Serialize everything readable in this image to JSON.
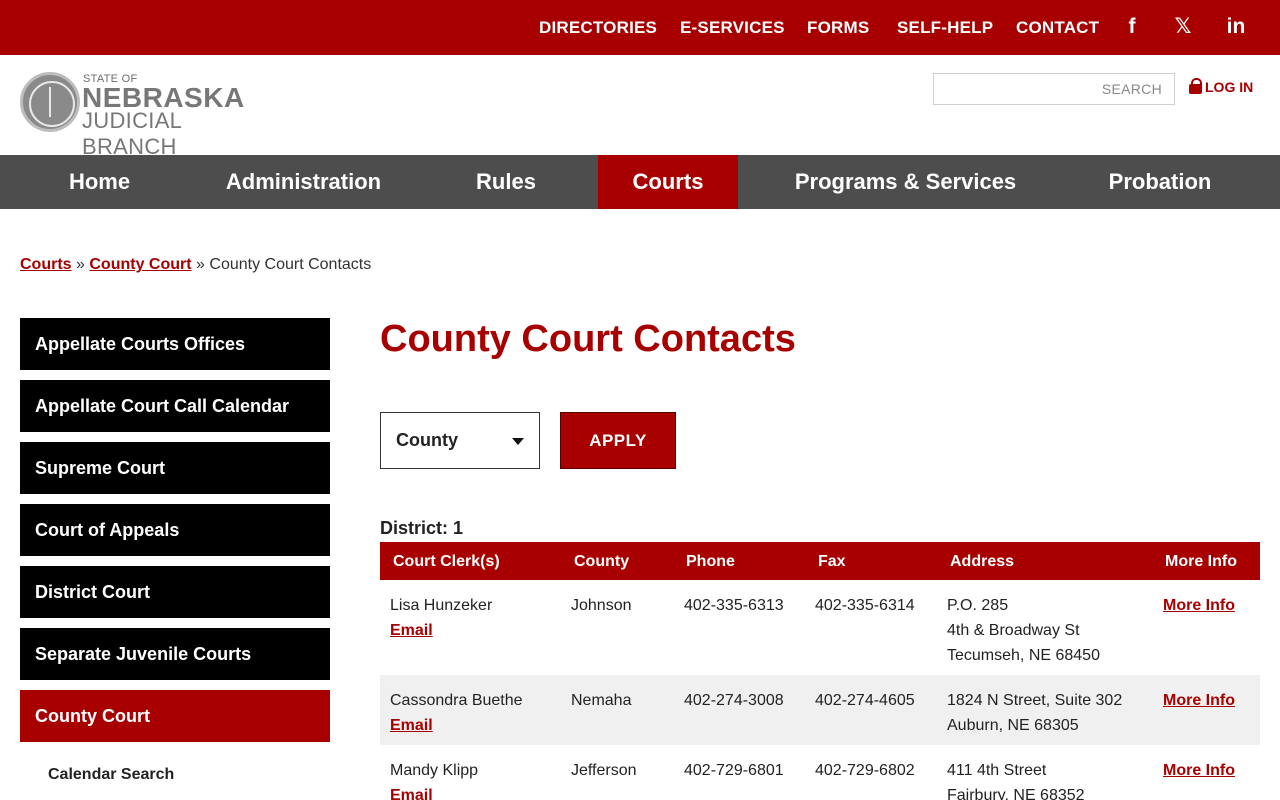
{
  "colors": {
    "brand_red": "#a80000",
    "nav_gray": "#4d4d4d",
    "sidebar_black": "#000000"
  },
  "top_links": [
    "DIRECTORIES",
    "E-SERVICES",
    "FORMS",
    "SELF-HELP",
    "CONTACT"
  ],
  "social": [
    {
      "icon": "facebook-icon",
      "glyph": "f"
    },
    {
      "icon": "x-icon",
      "glyph": "𝕏"
    },
    {
      "icon": "linkedin-icon",
      "glyph": "in"
    }
  ],
  "logo": {
    "line1": "STATE OF",
    "line2": "NEBRASKA",
    "line3": "JUDICIAL BRANCH"
  },
  "search": {
    "placeholder": "SEARCH"
  },
  "login": {
    "label": "LOG IN",
    "icon": "lock-icon"
  },
  "nav": [
    "Home",
    "Administration",
    "Rules",
    "Courts",
    "Programs & Services",
    "Probation"
  ],
  "nav_active": "Courts",
  "breadcrumb": {
    "crumb1": "Courts",
    "sep": "»",
    "crumb2": "County Court",
    "current": "County Court Contacts"
  },
  "sidebar": {
    "items": [
      "Appellate Courts Offices",
      "Appellate Court Call Calendar",
      "Supreme Court",
      "Court of Appeals",
      "District Court",
      "Separate Juvenile Courts",
      "County Court"
    ],
    "active": "County Court",
    "sub": "Calendar Search"
  },
  "page_title": "County Court Contacts",
  "filter": {
    "selected": "County",
    "apply_label": "APPLY"
  },
  "district_label": "District: 1",
  "table": {
    "headers": [
      "Court Clerk(s)",
      "County",
      "Phone",
      "Fax",
      "Address",
      "More Info"
    ],
    "email_label": "Email",
    "more_label": "More Info",
    "rows": [
      {
        "clerk": "Lisa Hunzeker",
        "county": "Johnson",
        "phone": "402-335-6313",
        "fax": "402-335-6314",
        "address": [
          "P.O. 285",
          "4th & Broadway St",
          "Tecumseh, NE 68450"
        ]
      },
      {
        "clerk": "Cassondra Buethe",
        "county": "Nemaha",
        "phone": "402-274-3008",
        "fax": "402-274-4605",
        "address": [
          "1824 N Street, Suite 302",
          "Auburn, NE 68305"
        ]
      },
      {
        "clerk": "Mandy Klipp",
        "county": "Jefferson",
        "phone": "402-729-6801",
        "fax": "402-729-6802",
        "address": [
          "411 4th Street",
          "Fairbury, NE 68352"
        ]
      }
    ]
  }
}
